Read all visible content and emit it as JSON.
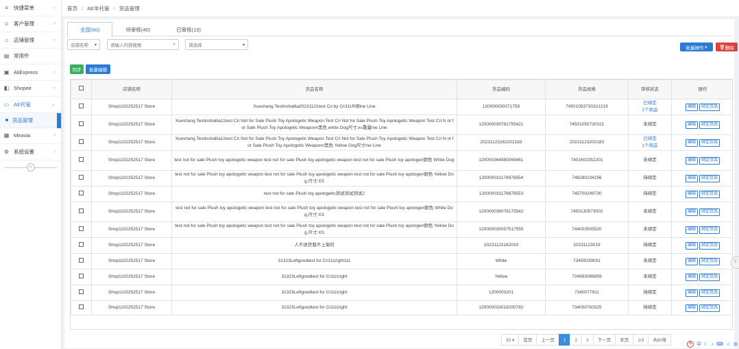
{
  "sidebar": {
    "items": [
      {
        "icon": "menu-icon",
        "label": "快捷菜单",
        "arrow": "‹"
      },
      {
        "icon": "user-icon",
        "label": "客户管理",
        "arrow": "‹"
      },
      {
        "icon": "store-icon",
        "label": "店铺管理",
        "arrow": "‹"
      },
      {
        "icon": "calendar-icon",
        "label": "常用件",
        "arrow": ""
      },
      {
        "icon": "aliexpress-icon",
        "label": "AliExpress",
        "arrow": "‹"
      },
      {
        "icon": "shopee-icon",
        "label": "Shopee",
        "arrow": "‹"
      },
      {
        "icon": "ae-icon",
        "label": "AE托管",
        "arrow": "⌄"
      }
    ],
    "sub_item": "货品管理",
    "items_after": [
      {
        "icon": "miravia-icon",
        "label": "Miravia",
        "arrow": "‹"
      },
      {
        "icon": "settings-icon",
        "label": "系统设置",
        "arrow": "‹"
      }
    ]
  },
  "breadcrumb": {
    "home": "首页",
    "section": "AE半托管",
    "page": "货品管理"
  },
  "tabs": [
    {
      "label": "全部(60)"
    },
    {
      "label": "待审核(40)"
    },
    {
      "label": "已审核(19)"
    }
  ],
  "filters": {
    "store_select": "店铺名称",
    "search_placeholder": "请输入内容搜索",
    "status_select": "请选择"
  },
  "buttons": {
    "batch_ops": "批量操作",
    "delete": "删除",
    "sync": "同步",
    "batch_edit": "批量编辑"
  },
  "table": {
    "headers": [
      "店铺名称",
      "货品名称",
      "货品编码",
      "货品规格",
      "审核状态",
      "操作"
    ],
    "action_edit": "编辑",
    "action_detail": "绑定货品",
    "rows": [
      {
        "check": false,
        "store": "Shop1102252517 Store",
        "title": "Xueshang Testinshallia20231121test Cri by Cri111R绑ine Line",
        "code": "120000030071759",
        "spec": "74501053730321219",
        "status": "已绑定",
        "status2": "1个商品",
        "status_class": "status-ok"
      },
      {
        "check": true,
        "store": "Shop1102252517 Store",
        "title": "Xueshang Testinshallia11test Cri Not for Sale Plush Toy Apologetic Weapon Test Cri Not for Sale Plush Toy Apologetic Weapon Test Cri N ot for Sale Plush Toy Apologetic Weapon#黑色 white Dog尺寸:xs重量ine Line",
        "code": "120000030781755421",
        "spec": "74501055730321",
        "status": "未绑定",
        "status2": "",
        "status_class": ""
      },
      {
        "check": true,
        "store": "Shop1102252517 Store",
        "title": "Xueshang Testinshallia11test Cri Not for Sale Plush Toy Apologetic Weapon Test Cri Not for Sale Plush Toy Apologetic Weapon Test Cri N ot for Sale Plush Toy Apologetic Weapon#黑色 Yellow Dog尺寸ine Line",
        "code": "20231123162202183",
        "spec": "20231123202183",
        "status": "已绑定",
        "status2": "1个商品",
        "status_class": "status-ok"
      },
      {
        "check": true,
        "store": "Shop1102252517 Store",
        "title": "test not for sale Plush toy apologetic weapon test not for sale Plush toy apologetic weapon test not for sale Plush toy apologe#颜色 White Dog",
        "code": "120000364880069461",
        "spec": "7401602352201",
        "status": "未绑定",
        "status2": "",
        "status_class": ""
      },
      {
        "check": true,
        "store": "Shop1102252517 Store",
        "title": "test not for sale Plush toy apologetic weapon test not for sale Plush toy apologetic weapon test not for sale Plush toy apologe#颜色 Yellow Dog,尺寸:XS",
        "code": "120000031178978554",
        "spec": "746280234256",
        "status": "待绑定",
        "status2": "",
        "status_class": ""
      },
      {
        "check": true,
        "store": "Shop1102252517 Store",
        "title": "test not for sale Plush toy apologetic测试测试测试2",
        "code": "120000031178878553",
        "spec": "745700249730",
        "status": "待绑定",
        "status2": "",
        "status_class": ""
      },
      {
        "check": true,
        "store": "Shop1102252517 Store",
        "title": "test not for sale Plush toy apologetic weapon test not for sale Plush toy apologetic weapon test not for sale Plush toy apologe#颜色 White Dog,尺寸:XS",
        "code": "120000036076175542",
        "spec": "7450130573002",
        "status": "未绑定",
        "status2": "",
        "status_class": ""
      },
      {
        "check": true,
        "store": "Shop1102252517 Store",
        "title": "test not for sale Plush toy apologetic weapon test not for sale Plush toy apologetic weapon test not for sale Plush toy apologe#颜色 Yellow Dog,尺寸:XS",
        "code": "120000030057517555",
        "spec": "744003505520",
        "status": "未绑定",
        "status2": "",
        "status_class": ""
      },
      {
        "check": true,
        "store": "Shop1102252517 Store",
        "title": "人不进货我不上架的",
        "code": "20231123162019",
        "spec": "20231123019",
        "status": "待绑定",
        "status2": "",
        "status_class": ""
      },
      {
        "check": true,
        "store": "Shop1102252517 Store",
        "title": "31323Leftgoodtest for Cri111right111",
        "code": "White",
        "spec": "73455039031",
        "status": "未绑定",
        "status2": "",
        "status_class": ""
      },
      {
        "check": true,
        "store": "Shop1102252517 Store",
        "title": "31323Leftgoodtest for Cri111right",
        "code": "Yellow",
        "spec": "734993086859",
        "status": "未绑定",
        "status2": "",
        "status_class": ""
      },
      {
        "check": true,
        "store": "Shop1102252517 Store",
        "title": "31323Leftgoodtest for Cri111right",
        "code": "1200003201",
        "spec": "7340077911",
        "status": "待绑定",
        "status2": "",
        "status_class": ""
      },
      {
        "check": true,
        "store": "Shop1102252517 Store",
        "title": "31323Leftgoodtest for Cri111right",
        "code": "120000033018200782",
        "spec": "734000763325",
        "status": "待绑定",
        "status2": "",
        "status_class": ""
      }
    ]
  },
  "pager": {
    "page_size": "30",
    "first": "首页",
    "prev": "上一页",
    "pages": [
      "1",
      "2",
      "3"
    ],
    "next": "下一页",
    "last": "末页",
    "count": "1/3",
    "goto": "共60条"
  }
}
